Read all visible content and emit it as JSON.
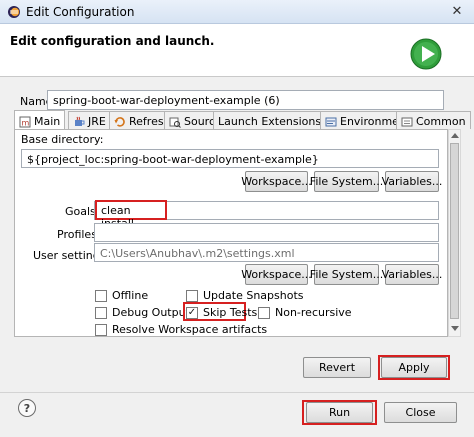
{
  "window": {
    "title": "Edit Configuration",
    "close_glyph": "✕"
  },
  "header": {
    "title": "Edit configuration and launch."
  },
  "name": {
    "label": "Name:",
    "value": "spring-boot-war-deployment-example (6)"
  },
  "tabs": [
    {
      "label": "Main",
      "icon": "maven-main-icon",
      "active": true
    },
    {
      "label": "JRE",
      "icon": "jre-icon"
    },
    {
      "label": "Refresh",
      "icon": "refresh-icon"
    },
    {
      "label": "Source",
      "icon": "source-icon"
    },
    {
      "label": "Launch Extensions",
      "icon": ""
    },
    {
      "label": "Environment",
      "icon": "environment-icon"
    },
    {
      "label": "Common",
      "icon": "common-icon"
    }
  ],
  "main": {
    "base_directory_label": "Base directory:",
    "base_directory_value": "${project_loc:spring-boot-war-deployment-example}",
    "workspace_btn": "Workspace...",
    "filesystem_btn": "File System...",
    "variables_btn": "Variables...",
    "goals_label": "Goals:",
    "goals_value": "clean install",
    "profiles_label": "Profiles:",
    "profiles_value": "",
    "user_settings_label": "User settings:",
    "user_settings_value": "C:\\Users\\Anubhav\\.m2\\settings.xml",
    "checkboxes": {
      "offline": {
        "label": "Offline",
        "checked": false
      },
      "update_snapshots": {
        "label": "Update Snapshots",
        "checked": false
      },
      "debug_output": {
        "label": "Debug Output",
        "checked": false
      },
      "skip_tests": {
        "label": "Skip Tests",
        "checked": true
      },
      "non_recursive": {
        "label": "Non-recursive",
        "checked": false
      },
      "resolve_workspace": {
        "label": "Resolve Workspace artifacts",
        "checked": false
      }
    }
  },
  "buttons": {
    "revert": "Revert",
    "apply": "Apply",
    "run": "Run",
    "close": "Close",
    "help": "?"
  },
  "colors": {
    "highlight_red": "#d62020",
    "run_green": "#2f9d3a"
  }
}
